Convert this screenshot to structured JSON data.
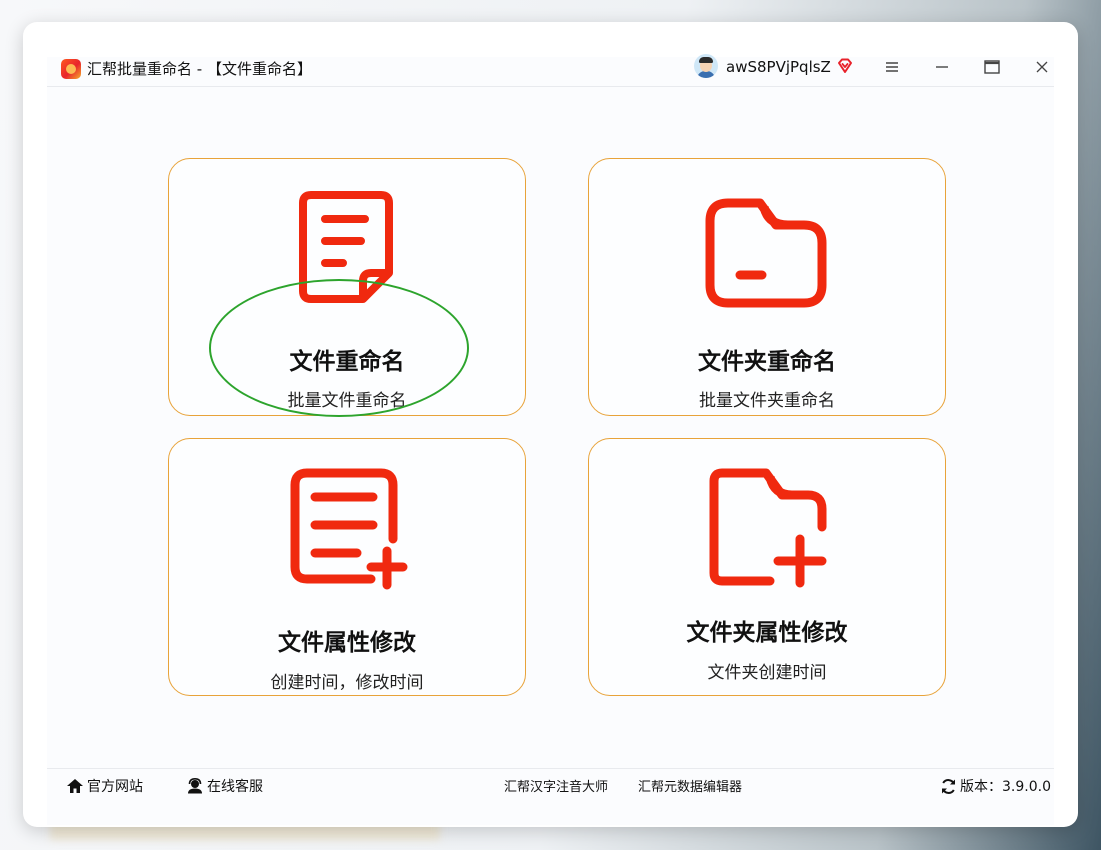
{
  "titlebar": {
    "app_title": "汇帮批量重命名 - 【文件重命名】",
    "username": "awS8PVjPqlsZ",
    "icons": [
      "app-logo-icon",
      "avatar-icon",
      "vip-diamond-icon",
      "menu-icon",
      "minimize-icon",
      "maximize-icon",
      "close-icon"
    ]
  },
  "cards": [
    {
      "title": "文件重命名",
      "subtitle": "批量文件重命名",
      "icon": "document-icon"
    },
    {
      "title": "文件夹重命名",
      "subtitle": "批量文件夹重命名",
      "icon": "folder-icon"
    },
    {
      "title": "文件属性修改",
      "subtitle": "创建时间，修改时间",
      "icon": "document-edit-icon"
    },
    {
      "title": "文件夹属性修改",
      "subtitle": "文件夹创建时间",
      "icon": "folder-add-icon"
    }
  ],
  "footer": {
    "official_site": "官方网站",
    "online_service": "在线客服",
    "pinyin_tool": "汇帮汉字注音大师",
    "metadata_tool": "汇帮元数据编辑器",
    "version": "版本：3.9.0.0"
  },
  "colors": {
    "accent_red": "#f0290f",
    "card_border": "#e8a33a",
    "highlight_green": "#2da42d"
  }
}
